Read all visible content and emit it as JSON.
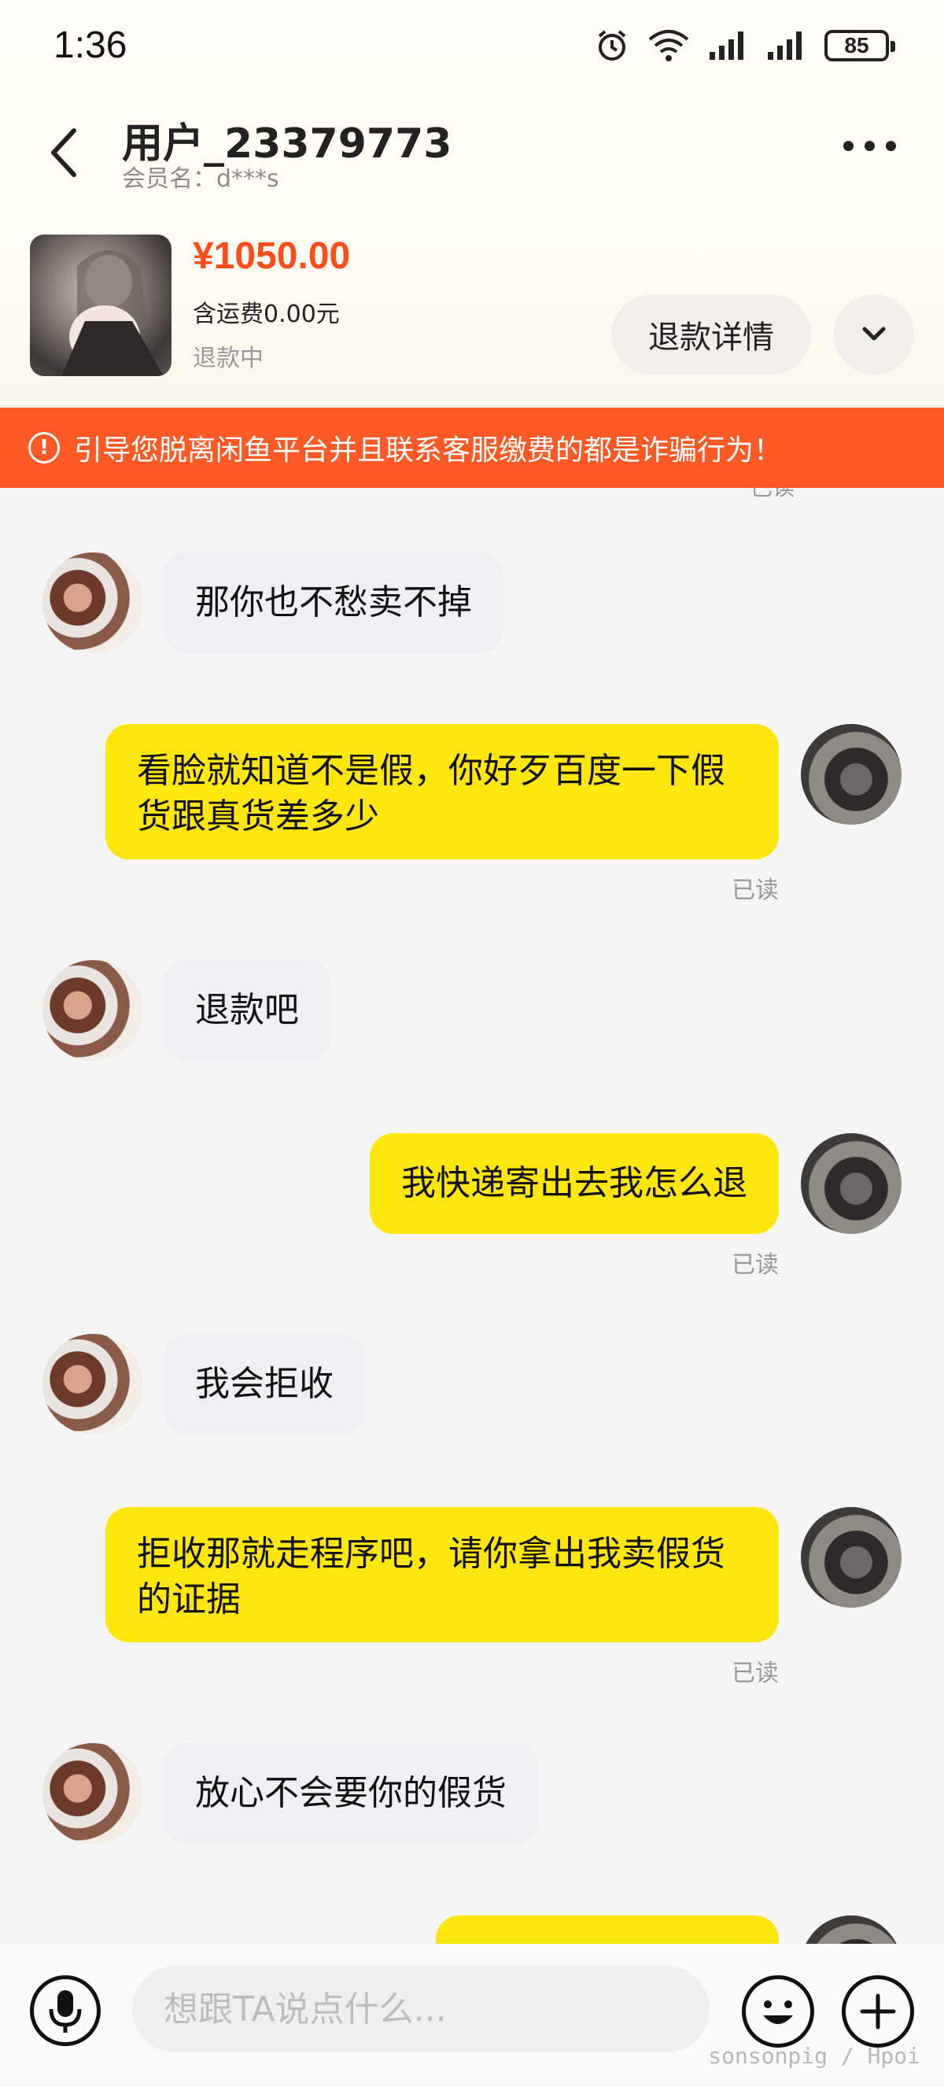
{
  "status_bar": {
    "time": "1:36",
    "battery": "85",
    "icons": [
      "alarm-icon",
      "wifi-icon",
      "signal-icon",
      "signal-icon",
      "battery-icon"
    ]
  },
  "header": {
    "title": "用户_23379773",
    "subtitle": "会员名：d***s"
  },
  "product": {
    "price": "¥1050.00",
    "shipping": "含运费0.00元",
    "status": "退款中",
    "refund_button": "退款详情"
  },
  "warning": {
    "text": "引导您脱离闲鱼平台并且联系客服缴费的都是诈骗行为！"
  },
  "messages": [
    {
      "side": "theirs",
      "text": "那你也不愁卖不掉"
    },
    {
      "side": "mine",
      "text": "看脸就知道不是假，你好歹百度一下假货跟真货差多少",
      "status": "已读"
    },
    {
      "side": "theirs",
      "text": "退款吧"
    },
    {
      "side": "mine",
      "text": "我快递寄出去我怎么退",
      "status": "已读"
    },
    {
      "side": "theirs",
      "text": "我会拒收"
    },
    {
      "side": "mine",
      "text": "拒收那就走程序吧，请你拿出我卖假货的证据",
      "status": "已读"
    },
    {
      "side": "theirs",
      "text": "放心不会要你的假货"
    }
  ],
  "top_read_partial": "已读",
  "input": {
    "placeholder": "想跟TA说点什么..."
  },
  "watermark": "sonsonpig / Hpoi",
  "colors": {
    "accent_orange": "#ff5a26",
    "price_red": "#ff4d1a",
    "my_bubble": "#ffe60f",
    "their_bubble": "#f0f0f2"
  }
}
